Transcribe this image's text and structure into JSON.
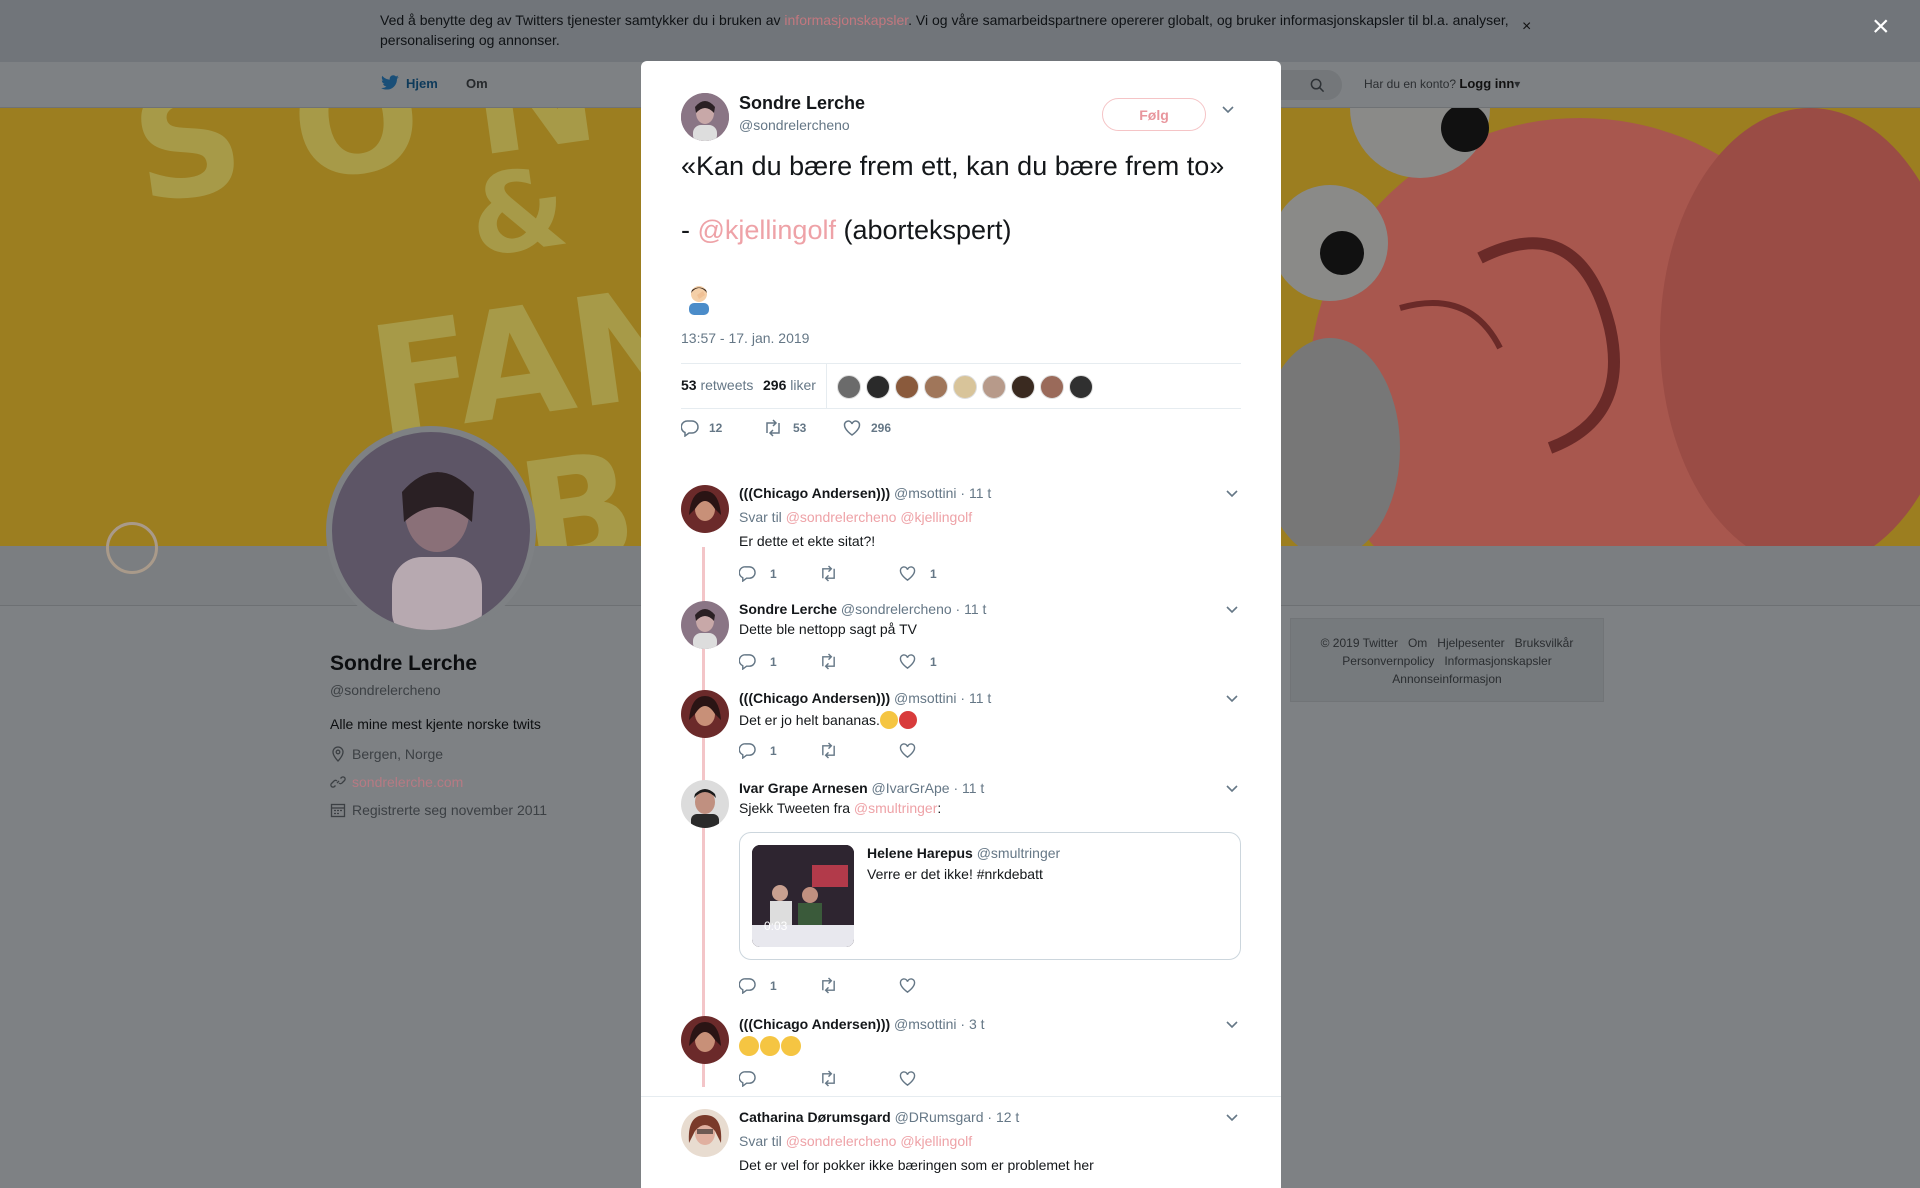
{
  "cookie_banner": {
    "text_before": "Ved å benytte deg av Twitters tjenester samtykker du i bruken av ",
    "link": "informasjonskapsler",
    "text_after": ". Vi og våre samarbeidspartnere opererer globalt, og bruker informasjonskapsler til bl.a. analyser, personalisering og annonser.",
    "close": "×"
  },
  "nav": {
    "home": "Hjem",
    "about": "Om",
    "account_prompt": "Har du en konto?",
    "login": "Logg inn"
  },
  "modal_close": "×",
  "profile": {
    "name": "Sondre Lerche",
    "handle": "@sondrelercheno",
    "bio": "Alle mine mest kjente norske twits",
    "location": "Bergen, Norge",
    "website": "sondrelerche.com",
    "joined": "Registrerte seg november 2011"
  },
  "footer": {
    "links_row1": [
      "© 2019 Twitter",
      "Om",
      "Hjelpesenter",
      "Bruksvilkår"
    ],
    "links_row2": [
      "Personvernpolicy",
      "Informasjonskapsler"
    ],
    "links_row3": [
      "Annonseinformasjon"
    ]
  },
  "tweet": {
    "author_name": "Sondre Lerche",
    "author_handle": "@sondrelercheno",
    "follow_label": "Følg",
    "line1": "«Kan du bære frem ett, kan du bære frem to»",
    "line2_prefix": "- ",
    "line2_mention": "@kjellingolf",
    "line2_suffix": " (abortekspert)",
    "timestamp": "13:57 - 17. jan. 2019",
    "retweets_count": "53",
    "retweets_label": "retweets",
    "likes_count": "296",
    "likes_label": "liker",
    "reply_count": "12",
    "retweet_count": "53",
    "like_count": "296",
    "liker_colors": [
      "#6b6b6b",
      "#2a2a2a",
      "#8a5a3c",
      "#a0765a",
      "#d8c49a",
      "#b79a8a",
      "#3a2a20",
      "#9a6a5a",
      "#303030"
    ]
  },
  "replies": [
    {
      "name": "(((Chicago Andersen)))",
      "handle": "@msottini",
      "time": "· 11 t",
      "reply_to_label": "Svar til",
      "reply_to": [
        "@sondrelercheno",
        "@kjellingolf"
      ],
      "text": "Er dette  et ekte sitat?!",
      "replies": "1",
      "likes": "1",
      "avatar_color": "#6b2a2a"
    },
    {
      "name": "Sondre Lerche",
      "handle": "@sondrelercheno",
      "time": "· 11 t",
      "text": "Dette ble nettopp sagt på TV",
      "replies": "1",
      "likes": "1",
      "avatar_color": "#8a7585"
    },
    {
      "name": "(((Chicago Andersen)))",
      "handle": "@msottini",
      "time": "· 11 t",
      "text": "Det er jo helt bananas.",
      "replies": "1",
      "likes": "",
      "avatar_color": "#6b2a2a"
    },
    {
      "name": "Ivar Grape Arnesen",
      "handle": "@IvarGrApe",
      "time": "· 11 t",
      "text_prefix": "Sjekk Tweeten fra ",
      "text_mention": "@smultringer",
      "text_suffix": ":",
      "quote": {
        "name": "Helene Harepus",
        "handle": "@smultringer",
        "text": "Verre er det ikke! #nrkdebatt",
        "video_time": "0:03"
      },
      "replies": "1",
      "likes": "",
      "avatar_color": "#3a3a3a"
    },
    {
      "name": "(((Chicago Andersen)))",
      "handle": "@msottini",
      "time": "· 3 t",
      "text": "",
      "replies": "",
      "likes": "",
      "avatar_color": "#6b2a2a"
    },
    {
      "name": "Catharina Dørumsgard",
      "handle": "@DRumsgard",
      "time": "· 12 t",
      "reply_to_label": "Svar til",
      "reply_to": [
        "@sondrelercheno",
        "@kjellingolf"
      ],
      "text": "Det er vel for pokker ikke bæringen som er problemet her",
      "avatar_color": "#7a3a2a"
    }
  ],
  "colors": {
    "accent": "#eea2a7",
    "secondary_text": "#657786",
    "thread_line": "#f3c5c8"
  }
}
